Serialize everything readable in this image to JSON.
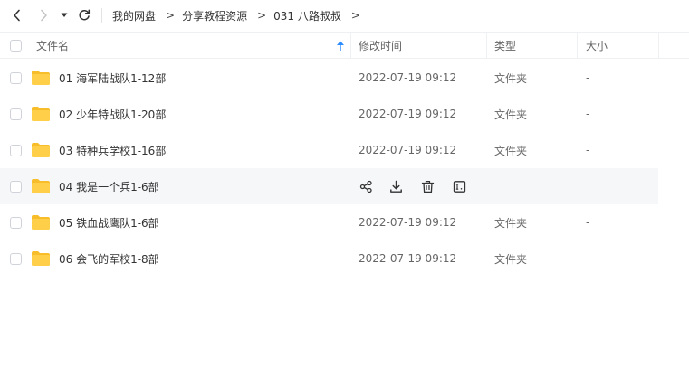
{
  "nav": {
    "breadcrumbs": [
      "我的网盘",
      "分享教程资源",
      "031 八路叔叔"
    ],
    "separator": ">"
  },
  "table": {
    "columns": {
      "name": "文件名",
      "modified": "修改时间",
      "type": "类型",
      "size": "大小"
    },
    "sort": {
      "column": "name",
      "direction": "ascending"
    },
    "rows": [
      {
        "name": "01 海军陆战队1-12部",
        "modified": "2022-07-19 09:12",
        "type": "文件夹",
        "size": "-"
      },
      {
        "name": "02 少年特战队1-20部",
        "modified": "2022-07-19 09:12",
        "type": "文件夹",
        "size": "-"
      },
      {
        "name": "03 特种兵学校1-16部",
        "modified": "2022-07-19 09:12",
        "type": "文件夹",
        "size": "-"
      },
      {
        "name": "04 我是一个兵1-6部",
        "modified": "",
        "type": "",
        "size": "",
        "hovered": true,
        "actions": [
          "share-icon",
          "download-icon",
          "delete-icon",
          "rename-icon"
        ]
      },
      {
        "name": "05 铁血战鹰队1-6部",
        "modified": "2022-07-19 09:12",
        "type": "文件夹",
        "size": "-"
      },
      {
        "name": "06 会飞的军校1-8部",
        "modified": "2022-07-19 09:12",
        "type": "文件夹",
        "size": "-"
      }
    ]
  },
  "colors": {
    "folder": "#ffcf4a",
    "folder_tab": "#f7bd2a",
    "sort_arrow": "#2b8cff",
    "hover_row": "#f6f7f9"
  }
}
